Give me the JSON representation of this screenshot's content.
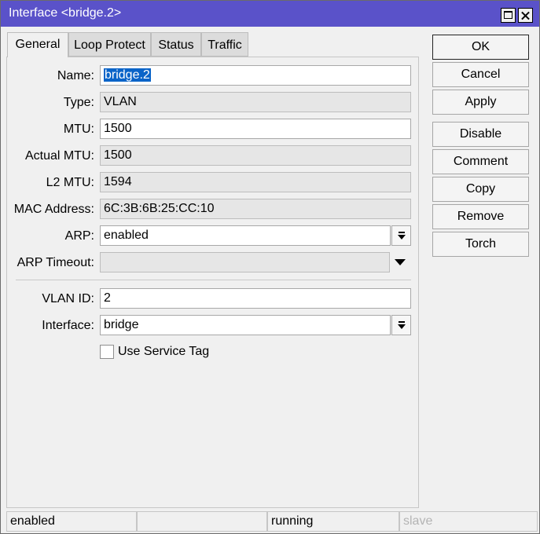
{
  "window": {
    "title": "Interface <bridge.2>"
  },
  "tabs": [
    {
      "label": "General",
      "active": true
    },
    {
      "label": "Loop Protect",
      "active": false
    },
    {
      "label": "Status",
      "active": false
    },
    {
      "label": "Traffic",
      "active": false
    }
  ],
  "form": {
    "name": {
      "label": "Name:",
      "value": "bridge.2"
    },
    "type": {
      "label": "Type:",
      "value": "VLAN"
    },
    "mtu": {
      "label": "MTU:",
      "value": "1500"
    },
    "actual_mtu": {
      "label": "Actual MTU:",
      "value": "1500"
    },
    "l2_mtu": {
      "label": "L2 MTU:",
      "value": "1594"
    },
    "mac_address": {
      "label": "MAC Address:",
      "value": "6C:3B:6B:25:CC:10"
    },
    "arp": {
      "label": "ARP:",
      "value": "enabled"
    },
    "arp_timeout": {
      "label": "ARP Timeout:",
      "value": ""
    },
    "vlan_id": {
      "label": "VLAN ID:",
      "value": "2"
    },
    "interface": {
      "label": "Interface:",
      "value": "bridge"
    },
    "use_service_tag": {
      "label": "Use Service Tag",
      "checked": false
    }
  },
  "buttons": {
    "ok": "OK",
    "cancel": "Cancel",
    "apply": "Apply",
    "disable": "Disable",
    "comment": "Comment",
    "copy": "Copy",
    "remove": "Remove",
    "torch": "Torch"
  },
  "statusbar": {
    "state": "enabled",
    "cell2": "",
    "run_state": "running",
    "slave": "slave"
  },
  "colors": {
    "titlebar": "#5a52c9",
    "selection": "#0a64c8"
  }
}
